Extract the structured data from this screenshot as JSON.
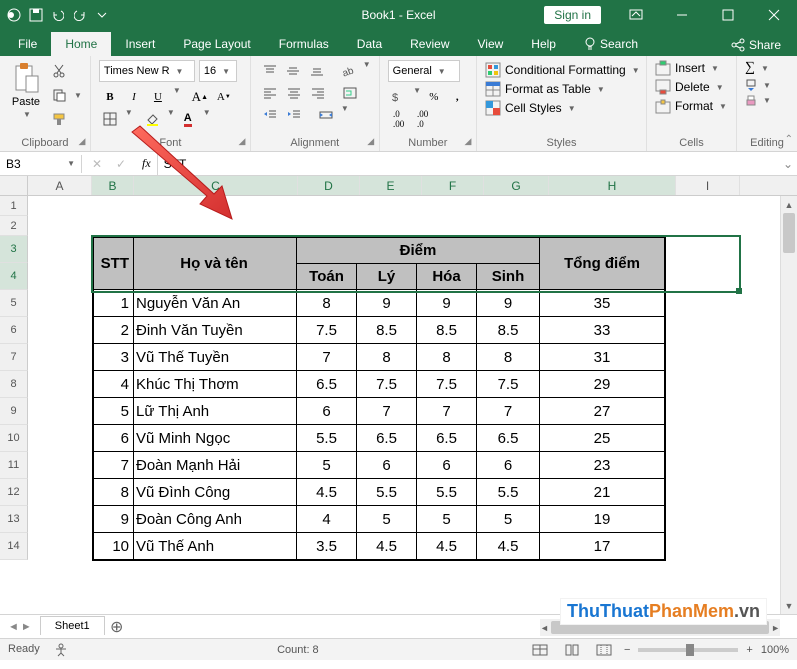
{
  "titlebar": {
    "doc_title": "Book1 - Excel",
    "signin": "Sign in"
  },
  "ribbon": {
    "tabs": [
      "File",
      "Home",
      "Insert",
      "Page Layout",
      "Formulas",
      "Data",
      "Review",
      "View",
      "Help"
    ],
    "active_tab": "Home",
    "search": "Search",
    "share": "Share",
    "groups": {
      "clipboard": "Clipboard",
      "paste": "Paste",
      "font": "Font",
      "font_name": "Times New R",
      "font_size": "16",
      "alignment": "Alignment",
      "number": "Number",
      "number_format": "General",
      "styles": "Styles",
      "cond_fmt": "Conditional Formatting",
      "fmt_table": "Format as Table",
      "cell_styles": "Cell Styles",
      "cells": "Cells",
      "insert": "Insert",
      "delete": "Delete",
      "format": "Format",
      "editing": "Editing"
    }
  },
  "formula_bar": {
    "name_box": "B3",
    "formula": "STT"
  },
  "columns": [
    "A",
    "B",
    "C",
    "D",
    "E",
    "F",
    "G",
    "H",
    "I"
  ],
  "row_headers": [
    "1",
    "2",
    "3",
    "4",
    "5",
    "6",
    "7",
    "8",
    "9",
    "10",
    "11",
    "12",
    "13",
    "14"
  ],
  "table_headers": {
    "stt": "STT",
    "name": "Họ và tên",
    "diem": "Điểm",
    "toan": "Toán",
    "ly": "Lý",
    "hoa": "Hóa",
    "sinh": "Sinh",
    "total": "Tổng điểm"
  },
  "table_rows": [
    {
      "stt": "1",
      "name": "Nguyễn Văn An",
      "toan": "8",
      "ly": "9",
      "hoa": "9",
      "sinh": "9",
      "total": "35"
    },
    {
      "stt": "2",
      "name": "Đinh Văn Tuyền",
      "toan": "7.5",
      "ly": "8.5",
      "hoa": "8.5",
      "sinh": "8.5",
      "total": "33"
    },
    {
      "stt": "3",
      "name": "Vũ Thế Tuyền",
      "toan": "7",
      "ly": "8",
      "hoa": "8",
      "sinh": "8",
      "total": "31"
    },
    {
      "stt": "4",
      "name": "Khúc Thị Thơm",
      "toan": "6.5",
      "ly": "7.5",
      "hoa": "7.5",
      "sinh": "7.5",
      "total": "29"
    },
    {
      "stt": "5",
      "name": "Lữ Thị Anh",
      "toan": "6",
      "ly": "7",
      "hoa": "7",
      "sinh": "7",
      "total": "27"
    },
    {
      "stt": "6",
      "name": "Vũ Minh Ngọc",
      "toan": "5.5",
      "ly": "6.5",
      "hoa": "6.5",
      "sinh": "6.5",
      "total": "25"
    },
    {
      "stt": "7",
      "name": "Đoàn Mạnh Hải",
      "toan": "5",
      "ly": "6",
      "hoa": "6",
      "sinh": "6",
      "total": "23"
    },
    {
      "stt": "8",
      "name": "Vũ Đình Công",
      "toan": "4.5",
      "ly": "5.5",
      "hoa": "5.5",
      "sinh": "5.5",
      "total": "21"
    },
    {
      "stt": "9",
      "name": "Đoàn Công Anh",
      "toan": "4",
      "ly": "5",
      "hoa": "5",
      "sinh": "5",
      "total": "19"
    },
    {
      "stt": "10",
      "name": "Vũ Thế Anh",
      "toan": "3.5",
      "ly": "4.5",
      "hoa": "4.5",
      "sinh": "4.5",
      "total": "17"
    }
  ],
  "sheet_tabs": {
    "sheet1": "Sheet1"
  },
  "status": {
    "ready": "Ready",
    "count": "Count: 8",
    "zoom": "100%"
  },
  "watermark": {
    "t1": "ThuThuat",
    "t2": "PhanMem",
    "t3": ".vn"
  },
  "chart_data": {
    "type": "table",
    "title": "Điểm",
    "columns": [
      "STT",
      "Họ và tên",
      "Toán",
      "Lý",
      "Hóa",
      "Sinh",
      "Tổng điểm"
    ],
    "rows": [
      [
        1,
        "Nguyễn Văn An",
        8,
        9,
        9,
        9,
        35
      ],
      [
        2,
        "Đinh Văn Tuyền",
        7.5,
        8.5,
        8.5,
        8.5,
        33
      ],
      [
        3,
        "Vũ Thế Tuyền",
        7,
        8,
        8,
        8,
        31
      ],
      [
        4,
        "Khúc Thị Thơm",
        6.5,
        7.5,
        7.5,
        7.5,
        29
      ],
      [
        5,
        "Lữ Thị Anh",
        6,
        7,
        7,
        7,
        27
      ],
      [
        6,
        "Vũ Minh Ngọc",
        5.5,
        6.5,
        6.5,
        6.5,
        25
      ],
      [
        7,
        "Đoàn Mạnh Hải",
        5,
        6,
        6,
        6,
        23
      ],
      [
        8,
        "Vũ Đình Công",
        4.5,
        5.5,
        5.5,
        5.5,
        21
      ],
      [
        9,
        "Đoàn Công Anh",
        4,
        5,
        5,
        5,
        19
      ],
      [
        10,
        "Vũ Thế Anh",
        3.5,
        4.5,
        4.5,
        4.5,
        17
      ]
    ]
  }
}
